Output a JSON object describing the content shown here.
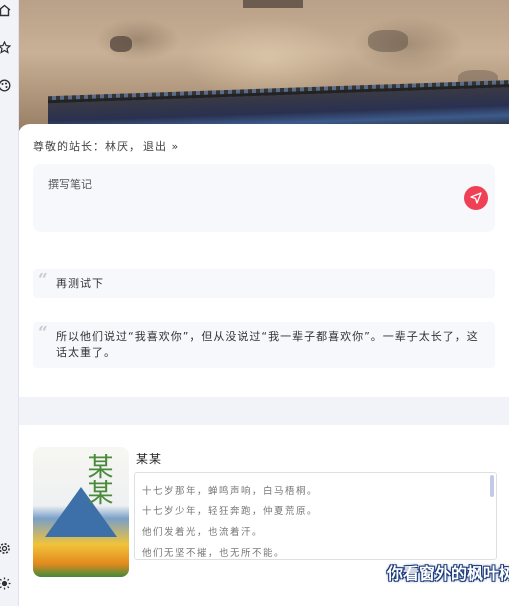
{
  "rail": {
    "icons": [
      "home-icon",
      "star-icon",
      "palette-icon",
      "gear-icon",
      "sun-icon"
    ]
  },
  "greeting": {
    "prefix": "尊敬的站长：",
    "name": "林厌",
    "comma": "，",
    "logout": "退出 »"
  },
  "note": {
    "placeholder": "撰写笔记"
  },
  "quotes": [
    {
      "text": "再测试下"
    },
    {
      "text": "所以他们说过“我喜欢你”，但从没说过“我一辈子都喜欢你”。一辈子太长了，这话太重了。"
    }
  ],
  "book": {
    "title": "某某",
    "cover_title": "某某",
    "lines": [
      "十七岁那年，蝉鸣声响，白马梧桐。",
      "十七岁少年，轻狂奔跑，仲夏荒原。",
      "他们发着光，也流着汗。",
      "他们无坚不摧，也无所不能。"
    ]
  },
  "caption": "你看窗外的枫叶树",
  "colors": {
    "accent": "#ef4056",
    "card_bg": "#ffffff",
    "quote_bg": "#f7f8fc",
    "page_bg": "#eef0f6"
  }
}
